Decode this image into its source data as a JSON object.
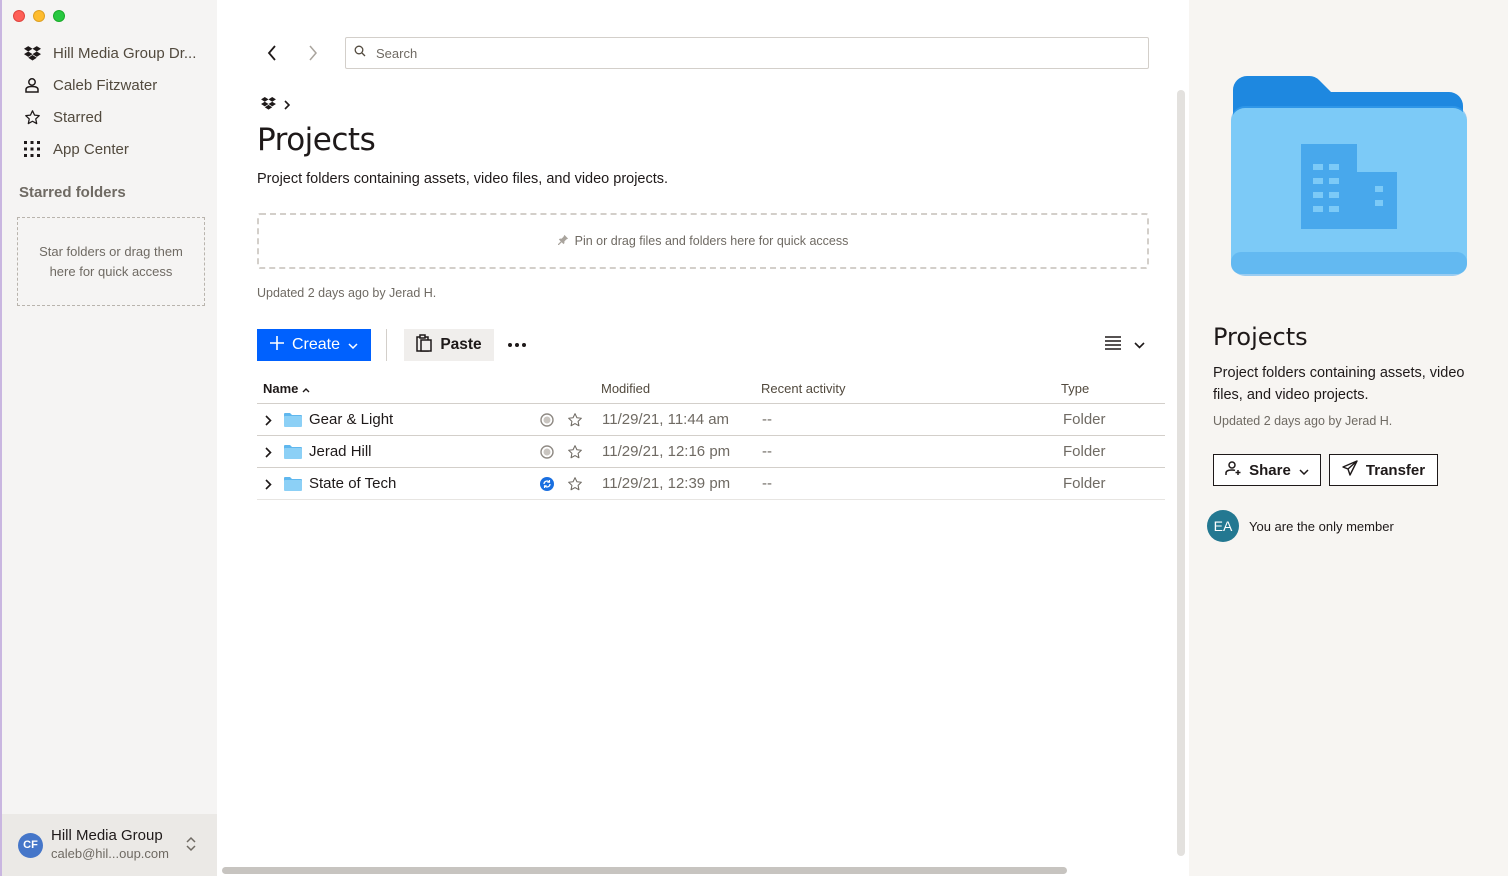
{
  "sidebar": {
    "nav": [
      {
        "label": "Hill Media Group Dr...",
        "icon": "dropbox-icon"
      },
      {
        "label": "Caleb Fitzwater",
        "icon": "person-icon"
      },
      {
        "label": "Starred",
        "icon": "star-icon"
      },
      {
        "label": "App Center",
        "icon": "grid-icon"
      }
    ],
    "starred_heading": "Starred folders",
    "starred_empty": "Star folders or drag them here for quick access",
    "account": {
      "initials": "CF",
      "name": "Hill Media Group",
      "email": "caleb@hil...oup.com"
    }
  },
  "search": {
    "placeholder": "Search"
  },
  "page": {
    "title": "Projects",
    "description": "Project folders containing assets, video files, and video projects.",
    "pin_text": "Pin or drag files and folders here for quick access",
    "updated": "Updated 2 days ago by Jerad H."
  },
  "toolbar": {
    "create_label": "Create",
    "paste_label": "Paste"
  },
  "table": {
    "columns": {
      "name": "Name",
      "modified": "Modified",
      "activity": "Recent activity",
      "type": "Type"
    },
    "rows": [
      {
        "name": "Gear & Light",
        "modified": "11/29/21, 11:44 am",
        "activity": "--",
        "type": "Folder",
        "sync": "idle"
      },
      {
        "name": "Jerad Hill",
        "modified": "11/29/21, 12:16 pm",
        "activity": "--",
        "type": "Folder",
        "sync": "idle"
      },
      {
        "name": "State of Tech",
        "modified": "11/29/21, 12:39 pm",
        "activity": "--",
        "type": "Folder",
        "sync": "syncing"
      }
    ]
  },
  "panel": {
    "title": "Projects",
    "description": "Project folders containing assets, video files, and video projects.",
    "updated": "Updated 2 days ago by Jerad H.",
    "share_label": "Share",
    "transfer_label": "Transfer",
    "member_initials": "EA",
    "member_text": "You are the only member"
  },
  "colors": {
    "accent": "#0061fe",
    "folder": "#5fb7ee",
    "sync_active": "#1a6fe0"
  }
}
